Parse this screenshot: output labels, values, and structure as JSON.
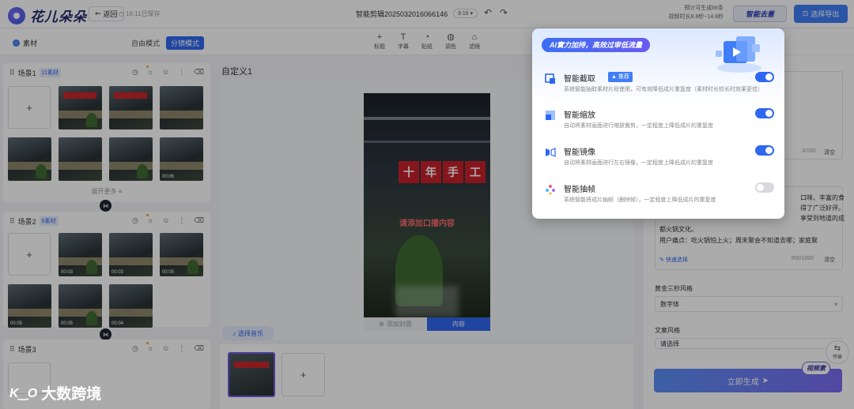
{
  "topbar": {
    "logo_text": "花儿朵朵",
    "back_label": "返回",
    "save_info": "16:11已保存",
    "project_title": "智能剪辑2025032016066146",
    "ratio": "9:16",
    "estimate_line1": "预计可生成66条",
    "estimate_line2": "视频时长8.8秒~14.8秒",
    "smart_go": "智能去重",
    "export_label": "选择导出"
  },
  "toolrow": {
    "material_tab": "素材",
    "modes": [
      "自由模式",
      "分镜模式"
    ],
    "tools": [
      {
        "icon": "plus-icon",
        "label": "标题"
      },
      {
        "icon": "text-icon",
        "label": "字幕"
      },
      {
        "icon": "sticker-icon",
        "label": "贴纸"
      },
      {
        "icon": "palette-icon",
        "label": "调色"
      },
      {
        "icon": "filter-icon",
        "label": "滤镜"
      }
    ]
  },
  "scenes": [
    {
      "title": "场景1",
      "count": "11素材",
      "more": "展开更多"
    },
    {
      "title": "场景2",
      "count": "6素材",
      "durations": [
        "00:03",
        "00:03",
        "00:05",
        "00:05",
        "00:05",
        "00:04"
      ]
    },
    {
      "title": "场景3"
    }
  ],
  "scene1_durations": [
    "00:06"
  ],
  "center": {
    "custom_title": "自定义1",
    "video_caption": "请添加口播内容",
    "video_sign": [
      "十",
      "年",
      "手",
      "工"
    ],
    "cover_tab": "添加封面",
    "content_tab": "内容",
    "music_btn": "选择音乐"
  },
  "right": {
    "counter1": "3/100",
    "clear1": "清空",
    "copy_text1": "口味、丰富的食",
    "copy_text2": "得了广泛好评。",
    "copy_text3": "享受到地道的成",
    "copy_text4": "都火锅文化。",
    "copy_text5": "用户痛点：吃火锅怕上火；周末聚会不知道去哪；家庭聚",
    "quick_select": "快速选择",
    "counter2": "356/1000",
    "clear2": "清空",
    "style_label": "黄金三秒风格",
    "style_value": "数字体",
    "copy_style_label": "文案风格",
    "copy_style_value": "请选择",
    "generate_btn": "立即生成",
    "float_tag": "视频素",
    "transfer_label": "传输"
  },
  "popup": {
    "title": "AI實力加持，高效过审低流量",
    "features": [
      {
        "icon": "crop-icon",
        "name": "智能截取",
        "badge": "推荐",
        "desc": "系统智能抽取素材片段使用，可有效降低成片重复度（素材时长较长时效果更佳）",
        "on": true
      },
      {
        "icon": "zoom-icon",
        "name": "智能缩放",
        "desc": "自动将素材画面进行缩放裁剪，一定程度上降低成片的重复度",
        "on": true
      },
      {
        "icon": "mirror-icon",
        "name": "智能镜像",
        "desc": "自动将素材画面进行左右镜像，一定程度上降低成片的重复度",
        "on": true
      },
      {
        "icon": "sparkle-icon",
        "name": "智能抽帧",
        "desc": "系统智能将成片抽帧（删除帧），一定程度上降低成片的重复度",
        "on": false
      }
    ]
  },
  "watermark": {
    "mark": "K‿O",
    "text": "大数跨境"
  },
  "colors": {
    "accent": "#2f67f0",
    "brand_dark": "#262a6e",
    "toggle_off": "#d7d9de"
  }
}
